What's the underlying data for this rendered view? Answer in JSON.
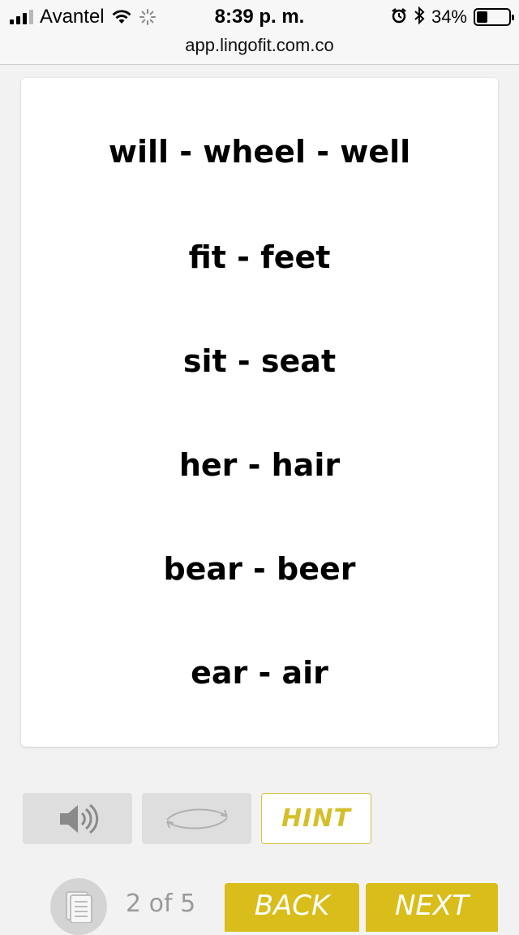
{
  "status_bar": {
    "carrier": "Avantel",
    "time": "8:39 p. m.",
    "battery_percent": "34%",
    "battery_level": 0.34,
    "url": "app.lingofit.com.co"
  },
  "card": {
    "lines": [
      "will - wheel - well",
      "fit - feet",
      "sit - seat",
      "her - hair",
      "bear - beer",
      "ear - air"
    ]
  },
  "controls": {
    "audio_icon": "speaker-icon",
    "flip_icon": "flip-arrows-icon",
    "hint_label": "HINT"
  },
  "footer": {
    "page_icon": "document-icon",
    "page_count": "2 of 5",
    "back_label": "BACK",
    "next_label": "NEXT"
  },
  "colors": {
    "accent": "#d9bd1a",
    "hint_text": "#d4bf2a",
    "background": "#f2f2f2"
  }
}
